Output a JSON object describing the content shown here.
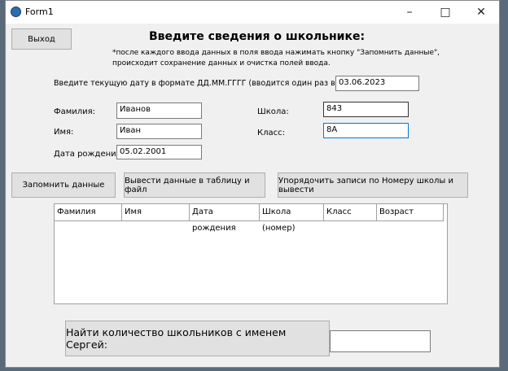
{
  "window": {
    "title": "Form1",
    "minimize_icon": "minimize-icon",
    "maximize_icon": "maximize-icon",
    "close_icon": "close-icon"
  },
  "exit_label": "Выход",
  "heading": "Введите сведения о школьнике:",
  "note_line1": "*после каждого ввода данных в поля ввода нажимать кнопку \"Запомнить данные\",",
  "note_line2": "происходит сохранение данных и очистка полей ввода.",
  "date_prompt": "Введите текущую дату в формате ДД.ММ.ГГГГ (вводится один раз в начале):",
  "current_date": "03.06.2023",
  "fields": {
    "surname": {
      "label": "Фамилия:",
      "value": "Иванов"
    },
    "name": {
      "label": "Имя:",
      "value": "Иван"
    },
    "birth": {
      "label": "Дата рождения:",
      "value": "05.02.2001"
    },
    "school": {
      "label": "Школа:",
      "value": "843"
    },
    "class": {
      "label": "Класс:",
      "value": "8А"
    }
  },
  "buttons": {
    "save": "Запомнить данные",
    "output": "Вывести данные в таблицу и файл",
    "sort": "Упорядочить записи по Номеру школы и вывести"
  },
  "table": {
    "columns": [
      "Фамилия",
      "Имя",
      "Дата рождения",
      "Школа (номер)",
      "Класс",
      "Возраст"
    ],
    "rows": []
  },
  "find_label": "Найти количество школьников с именем Сергей:",
  "find_result": ""
}
